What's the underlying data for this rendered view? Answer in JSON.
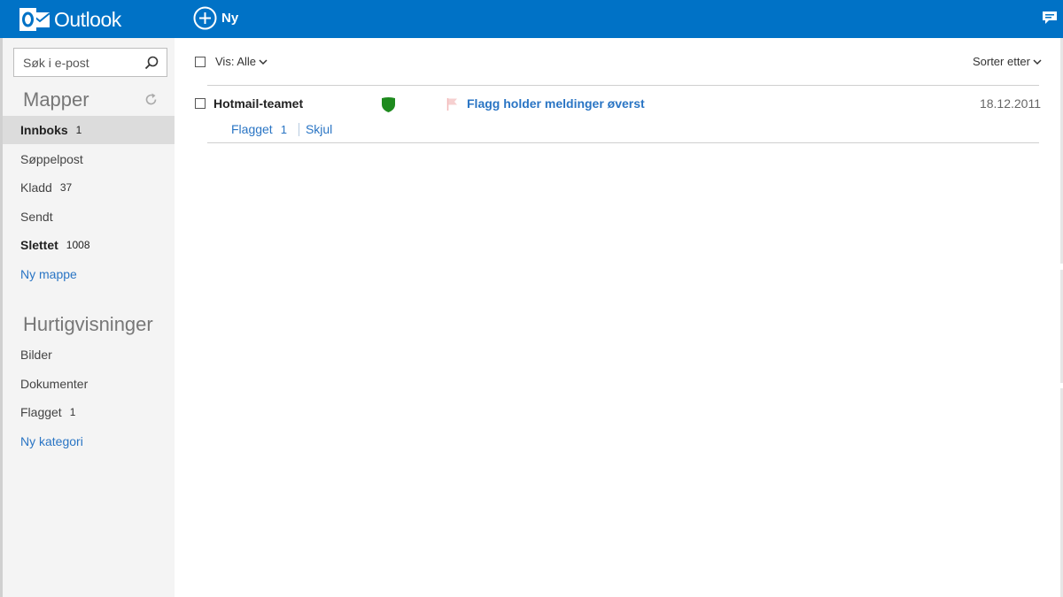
{
  "header": {
    "app_name": "Outlook",
    "new_label": "Ny",
    "brand_color": "#0072c6"
  },
  "sidebar": {
    "search_placeholder": "Søk i e-post",
    "folders_title": "Mapper",
    "folders": [
      {
        "label": "Innboks",
        "count": "1"
      },
      {
        "label": "Søppelpost",
        "count": ""
      },
      {
        "label": "Kladd",
        "count": "37"
      },
      {
        "label": "Sendt",
        "count": ""
      },
      {
        "label": "Slettet",
        "count": "1008"
      }
    ],
    "new_folder": "Ny mappe",
    "quickviews_title": "Hurtigvisninger",
    "quickviews": [
      {
        "label": "Bilder",
        "count": ""
      },
      {
        "label": "Dokumenter",
        "count": ""
      },
      {
        "label": "Flagget",
        "count": "1"
      }
    ],
    "new_category": "Ny kategori"
  },
  "toolbar": {
    "view_label": "Vis: Alle",
    "sort_label": "Sorter etter"
  },
  "messages": [
    {
      "sender": "Hotmail-teamet",
      "subject": "Flagg holder meldinger øverst",
      "date": "18.12.2011",
      "trusted_icon": "shield-icon",
      "flag_icon": "flag-icon"
    }
  ],
  "filter": {
    "label": "Flagget",
    "count": "1",
    "hide": "Skjul"
  },
  "colors": {
    "link": "#2a75c4",
    "shield": "#1e8a1e",
    "flag": "#f2b8b8"
  }
}
